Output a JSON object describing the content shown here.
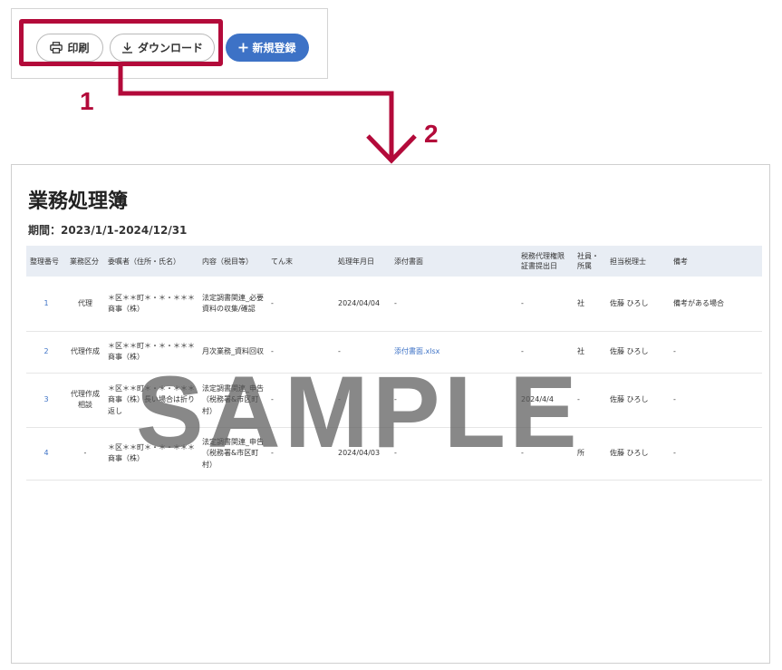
{
  "toolbar": {
    "print_label": "印刷",
    "download_label": "ダウンロード",
    "new_label": "新規登録",
    "accent_color": "#3d72c6"
  },
  "annotations": {
    "step1": "1",
    "step2": "2",
    "highlight_color": "#b30a3a"
  },
  "document": {
    "title": "業務処理簿",
    "period": "期間：2023/1/1-2024/12/31",
    "columns": [
      "整理番号",
      "業務区分",
      "委嘱者（住所・氏名）",
      "内容（税目等）",
      "てん末",
      "処理年月日",
      "添付書面",
      "税務代理権限証書提出日",
      "社員・所属",
      "担当税理士",
      "備考"
    ],
    "rows": [
      {
        "no": "1",
        "category": "代理",
        "client": "＊区＊＊町＊・＊・＊＊＊商事（株）",
        "content": "法定調書関連_必要資料の収集/確認",
        "outcome": "-",
        "date": "2024/04/04",
        "attachment": "-",
        "proxy_date": "-",
        "staff": "社",
        "accountant": "佐藤 ひろし",
        "remarks": "備考がある場合"
      },
      {
        "no": "2",
        "category": "代理作成",
        "client": "＊区＊＊町＊・＊・＊＊＊商事（株）",
        "content": "月次業務_資料回収",
        "outcome": "-",
        "date": "-",
        "attachment": "添付書面.xlsx",
        "proxy_date": "-",
        "staff": "社",
        "accountant": "佐藤 ひろし",
        "remarks": "-"
      },
      {
        "no": "3",
        "category": "代理作成相談",
        "client": "＊区＊＊町＊・＊・＊＊＊商事（株）長い場合は折り返し",
        "content": "法定調書関連_申告（税務署&市区町村）",
        "outcome": "-",
        "date": "-",
        "attachment": "-",
        "proxy_date": "2024/4/4",
        "staff": "-",
        "accountant": "佐藤 ひろし",
        "remarks": "-"
      },
      {
        "no": "4",
        "category": "-",
        "client": "＊区＊＊町＊・＊・＊＊＊商事（株）",
        "content": "法定調書関連_申告（税務署&市区町村）",
        "outcome": "-",
        "date": "2024/04/03",
        "attachment": "-",
        "proxy_date": "-",
        "staff": "所",
        "accountant": "佐藤 ひろし",
        "remarks": "-"
      }
    ],
    "watermark": "SAMPLE"
  }
}
